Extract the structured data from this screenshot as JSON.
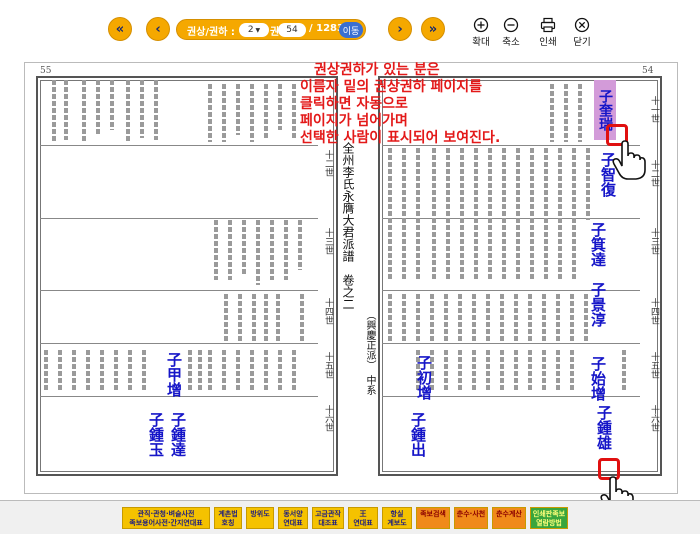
{
  "toolbar": {
    "first_icon": "double-chevron-left",
    "prev_icon": "chevron-left",
    "next_icon": "chevron-right",
    "last_icon": "double-chevron-right",
    "volume_label": "권상/권하 :",
    "volume_value": "2",
    "volume_unit": "권",
    "page_value": "54",
    "total_pages": "/ 1283",
    "go_label": "이동",
    "zoom_in_label": "확대",
    "zoom_out_label": "축소",
    "print_label": "인쇄",
    "close_label": "닫기"
  },
  "book": {
    "left_page_number": "55",
    "right_page_number": "54",
    "center_title": "全州李氏永膺大君派譜　卷之二",
    "center_sub": "（興慶正派）　中系",
    "generations_left": [
      "十二世",
      "十三世",
      "十四世",
      "十五世",
      "十六世"
    ],
    "generations_right": [
      "十一世",
      "十二世",
      "十三世",
      "十四世",
      "十五世",
      "十六世"
    ],
    "highlight_name": "子奎瑞",
    "names_right": [
      "子智復",
      "子箕達",
      "子景淳",
      "子始增",
      "子鍾雄"
    ],
    "names_center": [
      "子初增",
      "子鍾出"
    ],
    "names_left": [
      "子甲增",
      "子鍾玉",
      "子鍾達"
    ]
  },
  "callout": {
    "lines": [
      "권상권하가 있는 분은",
      "이름자 밑의 권상권하 페이지를",
      "클릭하면 자동으로",
      "페이지가 넘어가며",
      "선택한 사람이 표시되어 보여진다."
    ]
  },
  "bottom_buttons": [
    {
      "label": "관직·관청·벼슬사전\n족보용어사전·간지연대표"
    },
    {
      "label": "계촌법\n호칭"
    },
    {
      "label": "방위도"
    },
    {
      "label": "동서양\n연대표"
    },
    {
      "label": "고금관작\n대조표"
    },
    {
      "label": "王\n연대표"
    },
    {
      "label": "항실\n계보도"
    },
    {
      "label": "족보검색"
    },
    {
      "label": "춘수·사천"
    },
    {
      "label": "춘수계산"
    },
    {
      "label": "인쇄판족보\n열람방법"
    }
  ],
  "colors": {
    "accent": "#f5a800",
    "callout": "#e31919",
    "name_blue": "#1515c8",
    "highlight": "#d39bd9",
    "marker_red": "#e01010"
  }
}
